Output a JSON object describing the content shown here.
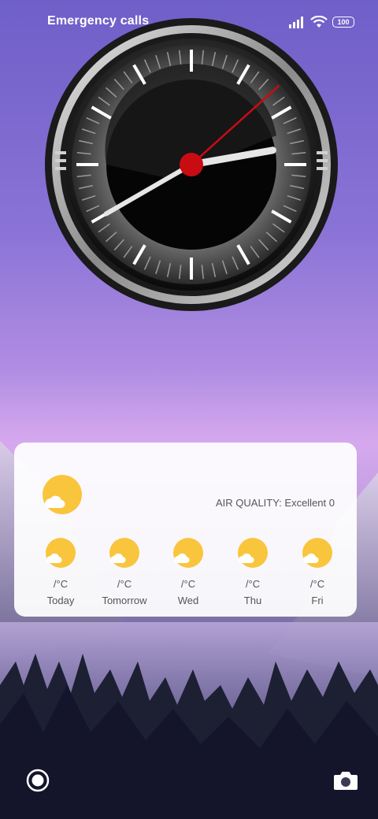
{
  "status_bar": {
    "text": "Emergency calls",
    "battery": "100",
    "icons": [
      "signal-icon",
      "wifi-icon",
      "battery-icon"
    ]
  },
  "clock": {
    "style": "analog",
    "hour": 2,
    "minute": 40,
    "second": 8,
    "accent_color": "#c80c12"
  },
  "weather": {
    "air_quality": "AIR QUALITY: Excellent 0",
    "icon": "partly-cloudy-icon",
    "days": [
      {
        "temp": "/°C",
        "name": "Today"
      },
      {
        "temp": "/°C",
        "name": "Tomorrow"
      },
      {
        "temp": "/°C",
        "name": "Wed"
      },
      {
        "temp": "/°C",
        "name": "Thu"
      },
      {
        "temp": "/°C",
        "name": "Fri"
      }
    ]
  },
  "bottom_bar": {
    "left_icon": "record-icon",
    "right_icon": "camera-icon"
  }
}
